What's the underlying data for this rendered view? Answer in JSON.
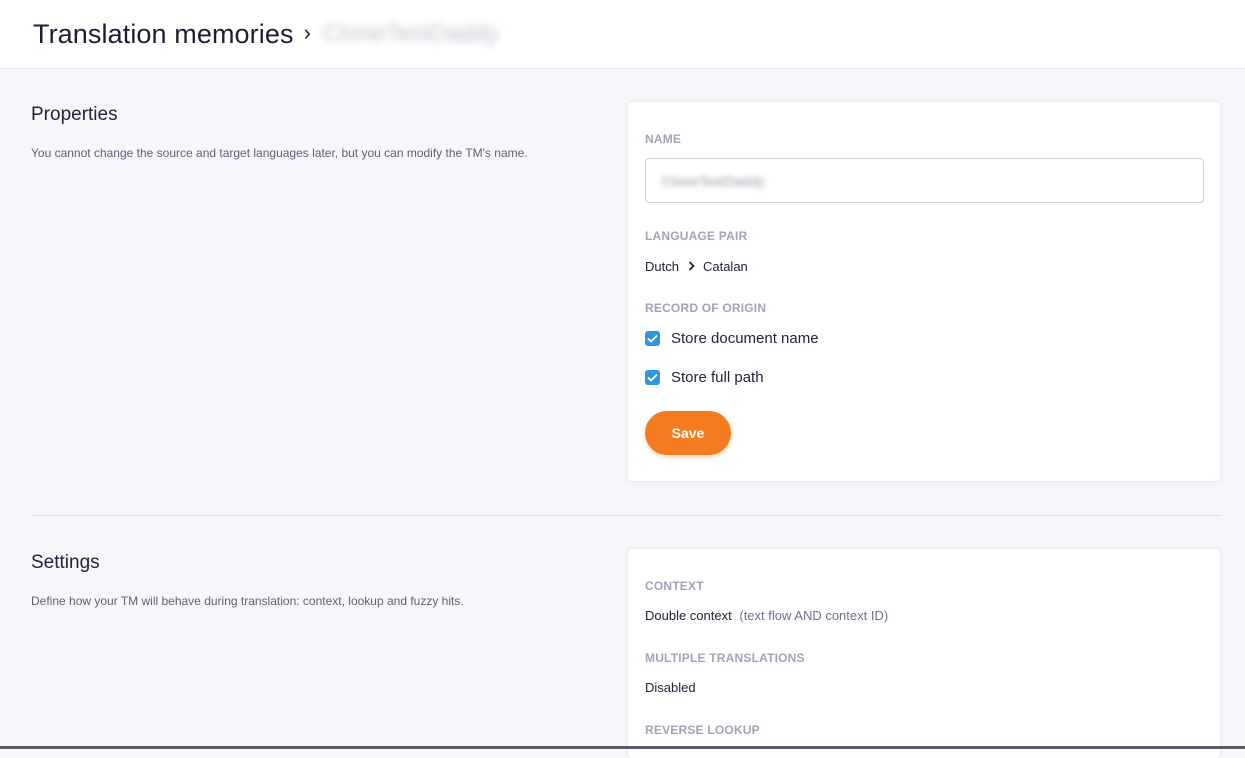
{
  "header": {
    "breadcrumb_root": "Translation memories",
    "breadcrumb_separator": "›",
    "breadcrumb_current": "CloneTestDaddy"
  },
  "properties": {
    "title": "Properties",
    "description": "You cannot change the source and target languages later, but you can modify the TM's name.",
    "name_label": "NAME",
    "name_value": "CloneTestDaddy",
    "language_pair_label": "LANGUAGE PAIR",
    "source_language": "Dutch",
    "target_language": "Catalan",
    "record_of_origin_label": "RECORD OF ORIGIN",
    "store_document_name_label": "Store document name",
    "store_document_name_checked": true,
    "store_full_path_label": "Store full path",
    "store_full_path_checked": true,
    "save_label": "Save"
  },
  "settings": {
    "title": "Settings",
    "description": "Define how your TM will behave during translation: context, lookup and fuzzy hits.",
    "context_label": "CONTEXT",
    "context_value": "Double context",
    "context_detail": "(text flow AND context ID)",
    "multiple_translations_label": "MULTIPLE TRANSLATIONS",
    "multiple_translations_value": "Disabled",
    "reverse_lookup_label": "REVERSE LOOKUP"
  },
  "colors": {
    "accent": "#f47b20",
    "checkbox": "#2f98dc"
  },
  "icons": {
    "checkbox": "check-icon",
    "language_arrow": "chevron-right-icon"
  }
}
